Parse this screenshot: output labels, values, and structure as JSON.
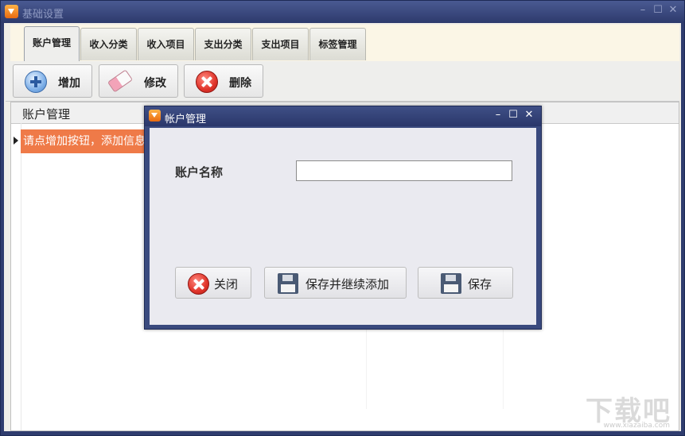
{
  "window": {
    "title": "基础设置",
    "minimize": "–",
    "maximize": "☐",
    "close": "✕"
  },
  "tabs": [
    {
      "label": "账户管理",
      "active": true
    },
    {
      "label": "收入分类"
    },
    {
      "label": "收入项目"
    },
    {
      "label": "支出分类"
    },
    {
      "label": "支出项目"
    },
    {
      "label": "标签管理"
    }
  ],
  "toolbar": {
    "add_label": "增加",
    "edit_label": "修改",
    "delete_label": "删除"
  },
  "grid": {
    "column_header": "账户管理",
    "selected_row_text": "请点增加按钮，添加信息"
  },
  "dialog": {
    "title": "帐户管理",
    "minimize": "–",
    "maximize": "☐",
    "close": "✕",
    "field_label": "账户名称",
    "field_value": "",
    "close_label": "关闭",
    "save_continue_label": "保存并继续添加",
    "save_label": "保存"
  },
  "watermark": {
    "text": "下载吧",
    "sub": "www.xiazaiba.com"
  },
  "colors": {
    "selected_row": "#ef7a48",
    "titlebar": "#2d3a6c",
    "tab_strip_bg": "#fbf6e6"
  }
}
